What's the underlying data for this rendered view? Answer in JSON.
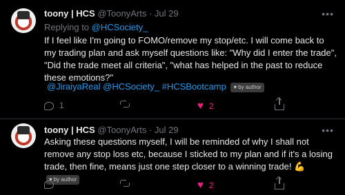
{
  "tweets": [
    {
      "display_name": "toony | HCS",
      "handle": "@ToonyArts",
      "separator": "·",
      "time": "Jul 29",
      "reply_prefix": "Replying to",
      "reply_to": "@HCSociety_",
      "text": "If I feel like I'm going to FOMO/remove my stop/etc. I will come back to my trading plan and ask myself questions like: \"Why did I enter the trade\", \"Did the trade meet all criteria\", \"what has helped in the past to reduce these emotions?\"",
      "tags": [
        "@JiraiyaReal",
        "@HCSociety_",
        "#HCSBootcamp"
      ],
      "badge": "by author",
      "replies": "1",
      "retweets": "",
      "likes": "2"
    },
    {
      "display_name": "toony | HCS",
      "handle": "@ToonyArts",
      "separator": "·",
      "time": "Jul 29",
      "text": "Asking these questions myself, I will be reminded of why I shall not remove any stop loss etc, because I sticked to my plan and if it's a losing trade, then fine, means just one step closer to a winning trade!",
      "emoji": "💪",
      "badge": "by author",
      "replies": "",
      "retweets": "",
      "likes": "2"
    }
  ],
  "icons": {
    "more": "more-icon",
    "reply": "reply-icon",
    "retweet": "retweet-icon",
    "like": "heart-icon",
    "share": "share-icon"
  },
  "colors": {
    "background": "#000000",
    "link": "#1d9bf0",
    "like": "#f91880",
    "muted": "#71767b"
  }
}
